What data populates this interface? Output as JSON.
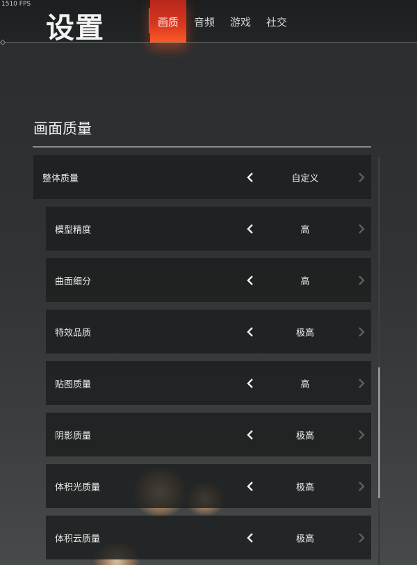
{
  "fps_counter": "1510 FPS",
  "page_title": "设置",
  "tabs": [
    {
      "label": "画质",
      "active": true
    },
    {
      "label": "音频",
      "active": false
    },
    {
      "label": "游戏",
      "active": false
    },
    {
      "label": "社交",
      "active": false
    }
  ],
  "section": {
    "title": "画面质量"
  },
  "settings": [
    {
      "label": "整体质量",
      "value": "自定义",
      "level": "main"
    },
    {
      "label": "模型精度",
      "value": "高",
      "level": "sub"
    },
    {
      "label": "曲面细分",
      "value": "高",
      "level": "sub"
    },
    {
      "label": "特效品质",
      "value": "极高",
      "level": "sub"
    },
    {
      "label": "贴图质量",
      "value": "高",
      "level": "sub"
    },
    {
      "label": "阴影质量",
      "value": "极高",
      "level": "sub"
    },
    {
      "label": "体积光质量",
      "value": "极高",
      "level": "sub"
    },
    {
      "label": "体积云质量",
      "value": "极高",
      "level": "sub"
    }
  ],
  "icons": {
    "prev": "chevron-left-icon",
    "next": "chevron-right-icon"
  },
  "colors": {
    "accent": "#d6371f",
    "arrow_active": "#f0f0f0",
    "arrow_disabled": "#5c5f60"
  },
  "scrollbar": {
    "position_fraction": 0.52
  }
}
